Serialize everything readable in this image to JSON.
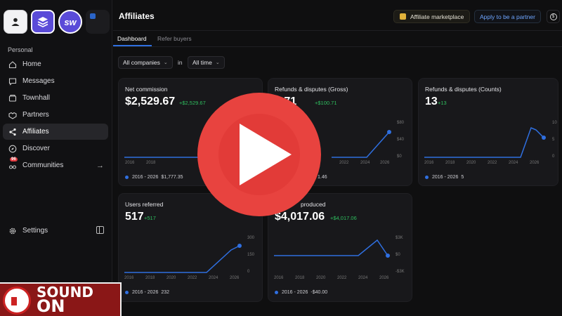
{
  "sidebar": {
    "section_label": "Personal",
    "items": [
      {
        "label": "Home",
        "icon": "home-icon"
      },
      {
        "label": "Messages",
        "icon": "messages-icon"
      },
      {
        "label": "Townhall",
        "icon": "townhall-icon"
      },
      {
        "label": "Partners",
        "icon": "handshake-icon"
      },
      {
        "label": "Affiliates",
        "icon": "share-icon",
        "active": true
      },
      {
        "label": "Discover",
        "icon": "compass-icon"
      },
      {
        "label": "Communities",
        "icon": "communities-icon",
        "badge": "96"
      }
    ],
    "settings_label": "Settings",
    "sw_tile_label": "sw"
  },
  "header": {
    "title": "Affiliates",
    "marketplace_label": "Affiliate marketplace",
    "partner_label": "Apply to be a partner",
    "dollar_symbol": "$"
  },
  "tabs": [
    {
      "label": "Dashboard",
      "active": true
    },
    {
      "label": "Refer buyers",
      "active": false
    }
  ],
  "filters": {
    "company": "All companies",
    "in_label": "in",
    "time": "All time"
  },
  "colors": {
    "accent": "#2f6fe0",
    "positive": "#2fbf5f",
    "play_red": "#e8433f"
  },
  "cards": [
    {
      "title": "Net commission",
      "value": "$2,529.67",
      "delta": "+$2,529.67",
      "years": [
        "2016",
        "2018"
      ],
      "legend_range": "2016 - 2026",
      "legend_value": "$1,777.35",
      "y_ticks": []
    },
    {
      "title": "Refunds & disputes (Gross)",
      "value": "0.71",
      "delta": "+$100.71",
      "years": [
        "2022",
        "2024",
        "2026"
      ],
      "legend_range": "",
      "legend_value": "1.46",
      "y_ticks": [
        "$80",
        "$40",
        "$0"
      ]
    },
    {
      "title": "Refunds & disputes (Counts)",
      "value": "13",
      "delta": "+13",
      "years": [
        "2016",
        "2018",
        "2020",
        "2022",
        "2024",
        "2026"
      ],
      "legend_range": "2016 - 2026",
      "legend_value": "5",
      "y_ticks": [
        "10",
        "5",
        "0"
      ]
    },
    {
      "title": "Users referred",
      "value": "517",
      "delta": "+517",
      "years": [
        "2016",
        "2018",
        "2020",
        "2022",
        "2024",
        "2026"
      ],
      "legend_range": "2016 - 2026",
      "legend_value": "232",
      "y_ticks": [
        "300",
        "150",
        "0"
      ]
    },
    {
      "title": "produced",
      "value": "$4,017.06",
      "delta": "+$4,017.06",
      "years": [
        "2016",
        "2018",
        "2020",
        "2022",
        "2024",
        "2026"
      ],
      "legend_range": "2016 - 2026",
      "legend_value": "-$40.00",
      "y_ticks": [
        "$3K",
        "$0",
        "-$3K"
      ]
    }
  ],
  "overlay": {
    "sound_line1": "SOUND",
    "sound_line2": "ON"
  }
}
